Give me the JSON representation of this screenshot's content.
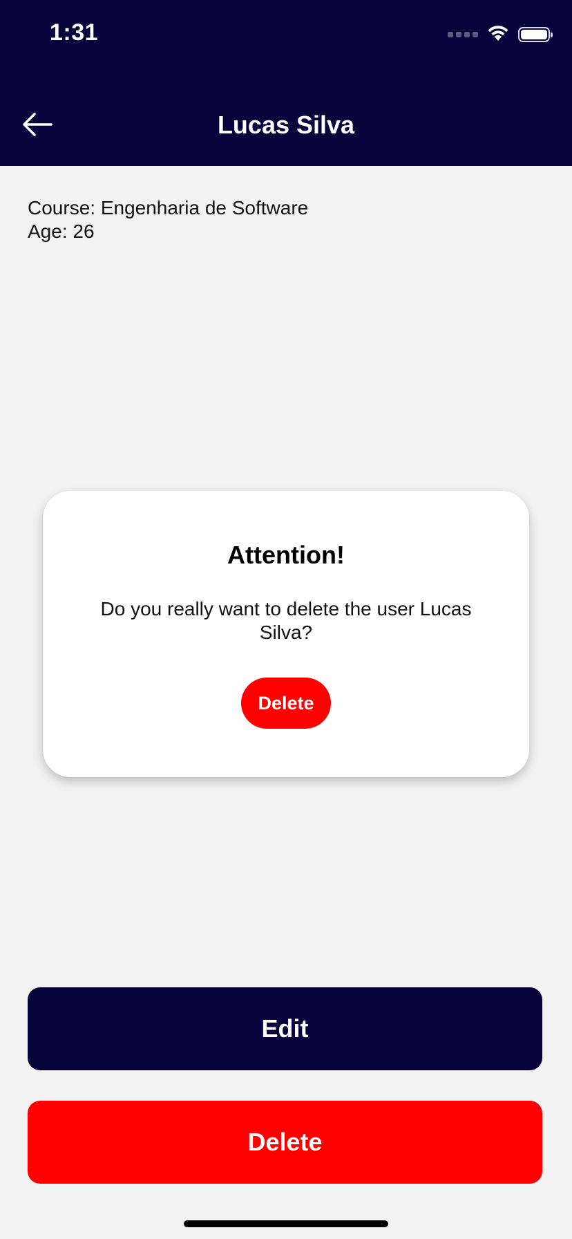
{
  "status_bar": {
    "time": "1:31"
  },
  "header": {
    "title": "Lucas Silva",
    "background_color": "#08033a",
    "back_icon": "arrow-left-icon"
  },
  "details": {
    "course": "Course: Engenharia de Software",
    "age": "Age: 26"
  },
  "dialog": {
    "title": "Attention!",
    "message": "Do you really want to delete the user Lucas Silva?",
    "delete_label": "Delete"
  },
  "actions": {
    "edit_label": "Edit",
    "delete_label": "Delete",
    "edit_color": "#08033a",
    "delete_color": "#ff0000"
  }
}
